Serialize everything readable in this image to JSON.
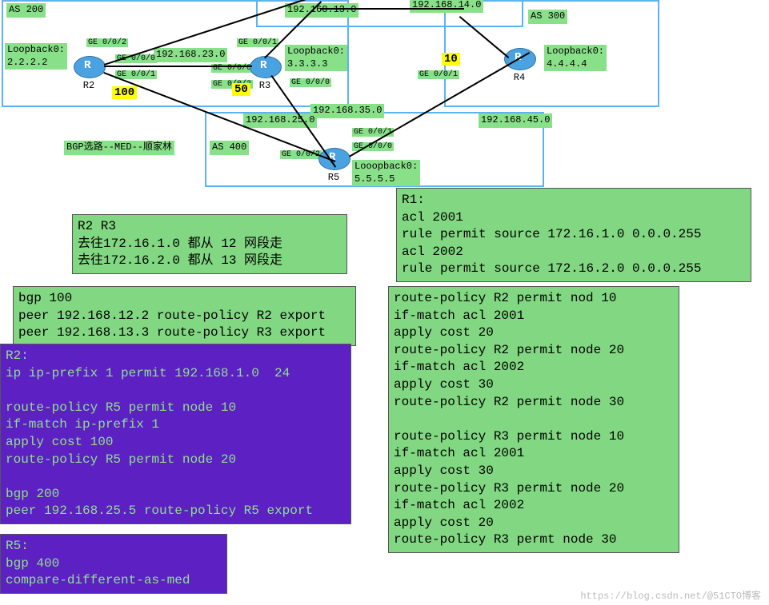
{
  "as": {
    "as200": "AS 200",
    "as300": "AS 300",
    "as400": "AS 400"
  },
  "routers": {
    "r2": "R2",
    "r3": "R3",
    "r4": "R4",
    "r5": "R5"
  },
  "loopbacks": {
    "r2": "Loopback0:\n2.2.2.2",
    "r3": "Loopback0:\n3.3.3.3",
    "r4": "Loopback0:\n4.4.4.4",
    "r5": "Looopback0:\n5.5.5.5"
  },
  "subnets": {
    "n23": "192.168.23.0",
    "n13": "192.168.13.0",
    "n14plus": "192.168.14.0",
    "n35": "192.168.35.0",
    "n25": "192.168.25.0",
    "n45": "192.168.45.0"
  },
  "ifs": {
    "r2_002": "GE 0/0/2",
    "r2_000": "GE 0/0/0",
    "r2_001": "GE 0/0/1",
    "r3_001": "GE 0/0/1",
    "r3_000": "GE 0/0/0",
    "r3_002": "GE 0/0/2",
    "r4_001": "GE 0/0/1",
    "r5_002": "GE 0/0/2",
    "r5_001": "GE 0/0/1",
    "r5_000": "GE 0/0/0"
  },
  "yellow": {
    "r2": "100",
    "r3": "50",
    "r4": "10"
  },
  "caption": "BGP选路--MED--顺家林",
  "boxes": {
    "r2r3_hint": "R2 R3\n去往172.16.1.0 都从 12 网段走\n去往172.16.2.0 都从 13 网段走",
    "r1_acl": "R1:\nacl 2001\nrule permit source 172.16.1.0 0.0.0.255\nacl 2002\nrule permit source 172.16.2.0 0.0.0.255",
    "bgp100": "bgp 100\npeer 192.168.12.2 route-policy R2 export\npeer 192.168.13.3 route-policy R3 export",
    "route_policy_r2r3": "route-policy R2 permit nod 10\nif-match acl 2001\napply cost 20\nroute-policy R2 permit node 20\nif-match acl 2002\napply cost 30\nroute-policy R2 permit node 30\n\nroute-policy R3 permit node 10\nif-match acl 2001\napply cost 30\nroute-policy R3 permit node 20\nif-match acl 2002\napply cost 20\nroute-policy R3 permt node 30",
    "r2_purple": "R2:\nip ip-prefix 1 permit 192.168.1.0  24\n\nroute-policy R5 permit node 10\nif-match ip-prefix 1\napply cost 100\nroute-policy R5 permit node 20\n\nbgp 200\npeer 192.168.25.5 route-policy R5 export",
    "r5_purple": "R5:\nbgp 400\ncompare-different-as-med"
  },
  "watermark": "https://blog.csdn.net/@51CTO博客"
}
